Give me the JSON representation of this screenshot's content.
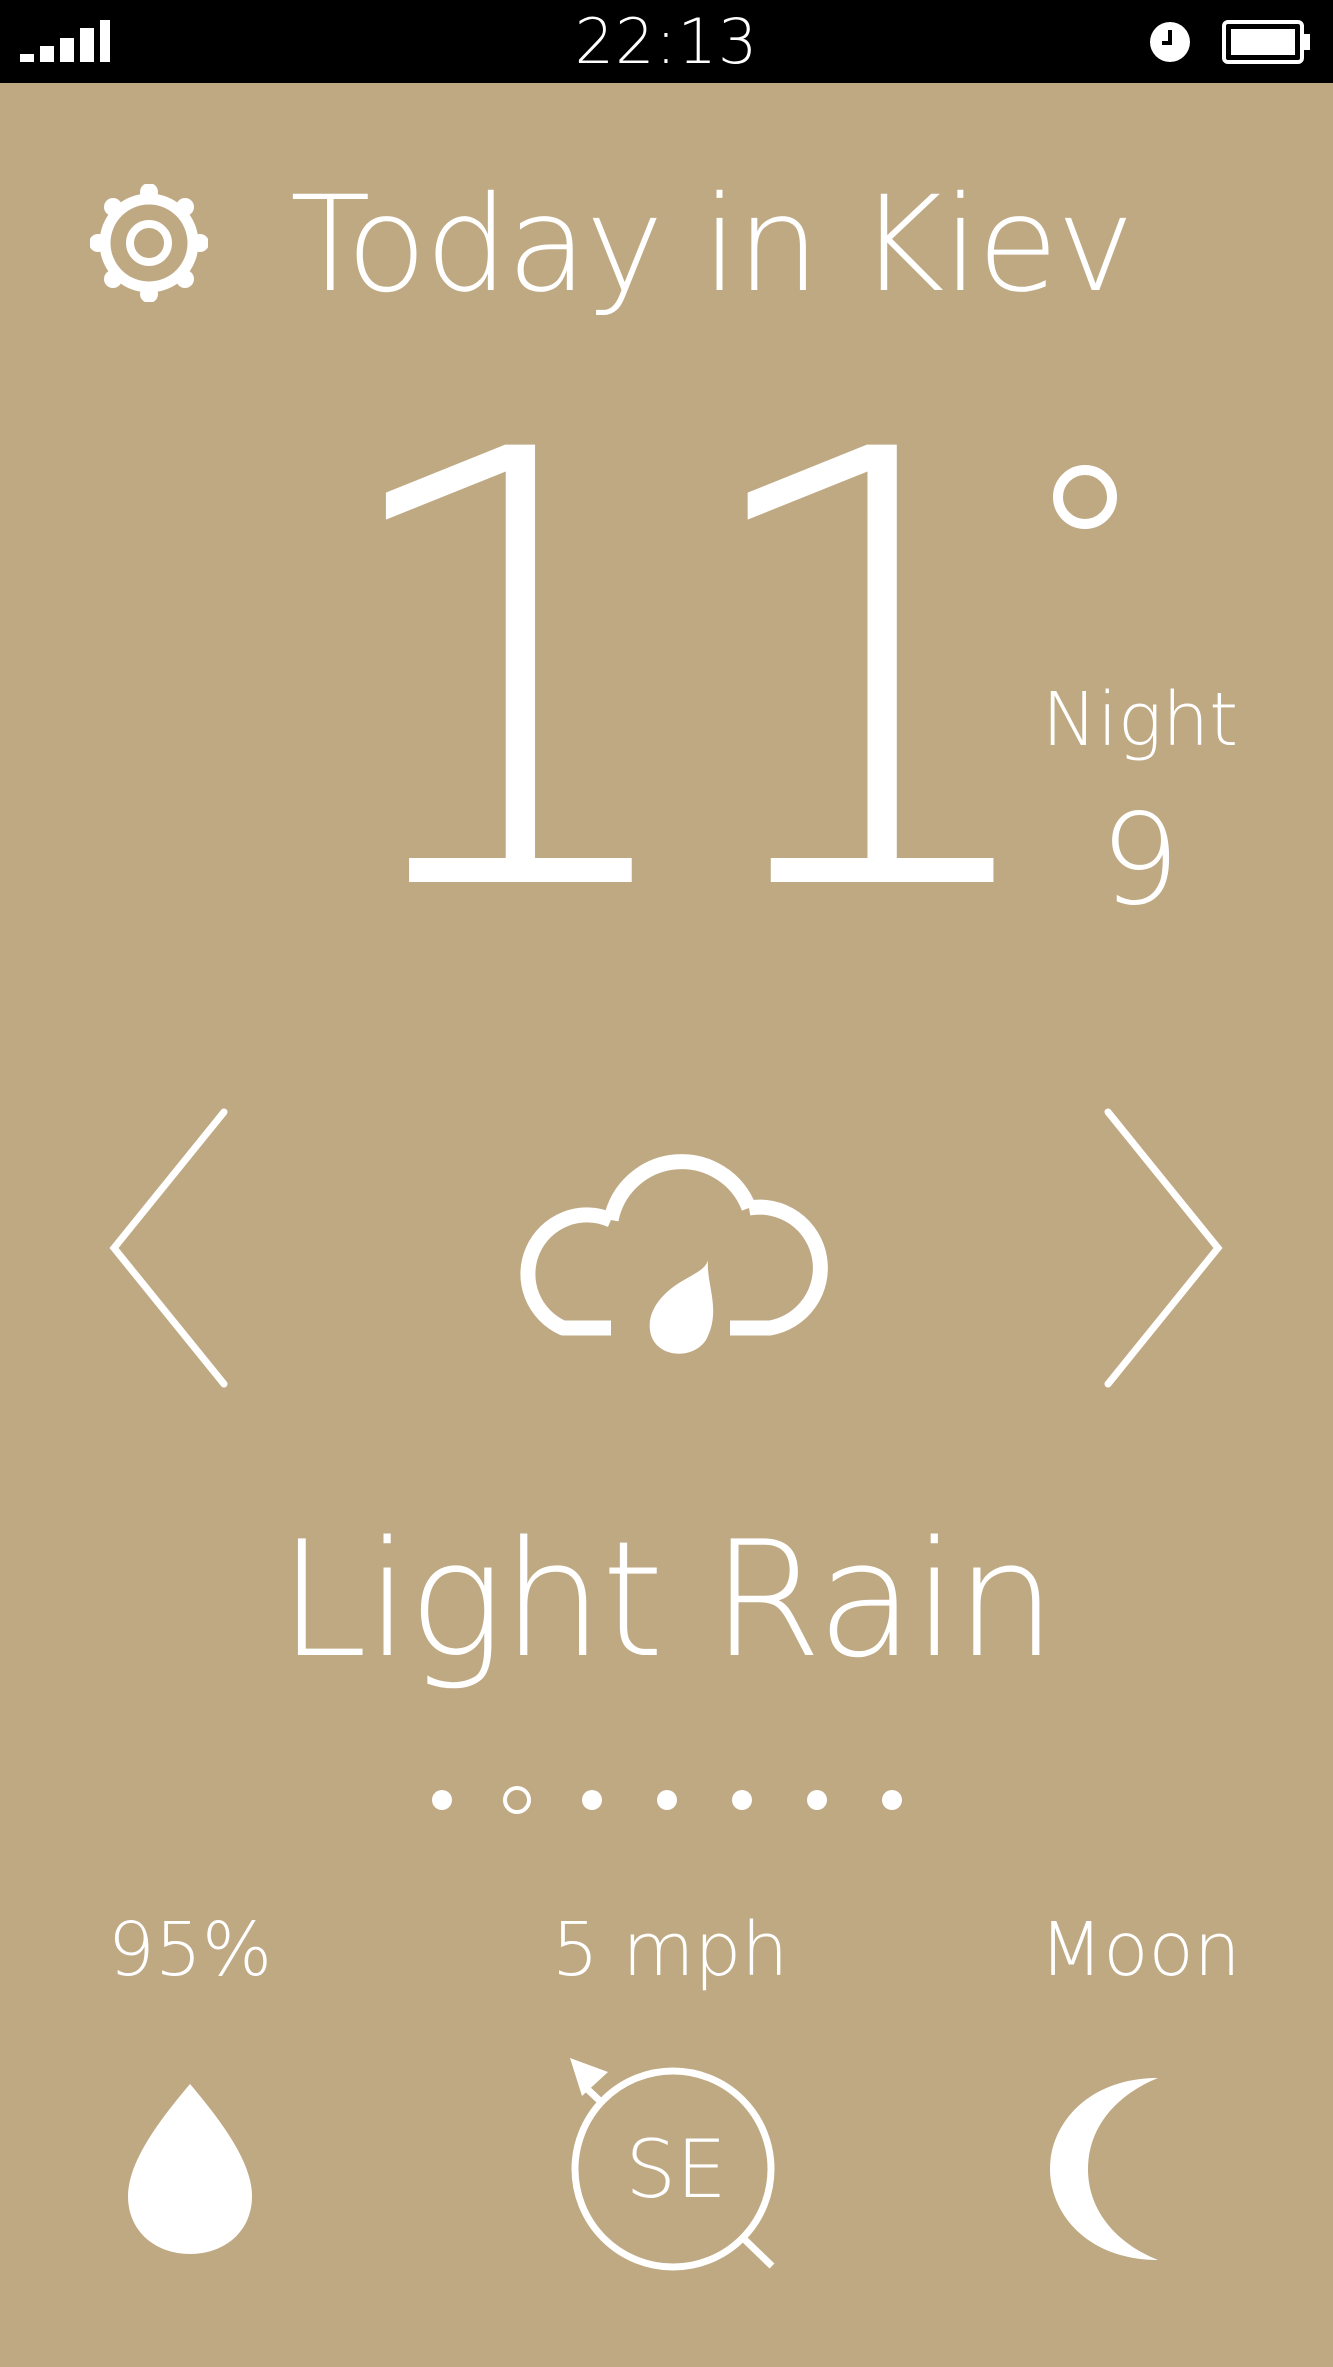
{
  "status_bar": {
    "time": "22:13",
    "signal_icon": "signal-bars-icon",
    "alarm_icon": "alarm-clock-icon",
    "battery_icon": "battery-icon"
  },
  "header": {
    "settings_icon": "gear-icon",
    "title": "Today in Kiev"
  },
  "temperature": {
    "current": "11",
    "degree_symbol": "°",
    "night_label": "Night",
    "night_value": "9"
  },
  "forecast": {
    "prev_icon": "chevron-left-icon",
    "next_icon": "chevron-right-icon",
    "condition_icon": "cloud-rain-drop-icon",
    "condition": "Light Rain",
    "page_count": 7,
    "active_page": 2
  },
  "details": {
    "humidity": "95%",
    "humidity_icon": "water-drop-icon",
    "wind_speed": "5 mph",
    "wind_direction": "SE",
    "wind_icon": "compass-arrow-icon",
    "moon_label": "Moon",
    "moon_icon": "crescent-moon-icon"
  },
  "colors": {
    "background": "#bfa983",
    "foreground": "#ffffff",
    "status_bar": "#000000"
  }
}
